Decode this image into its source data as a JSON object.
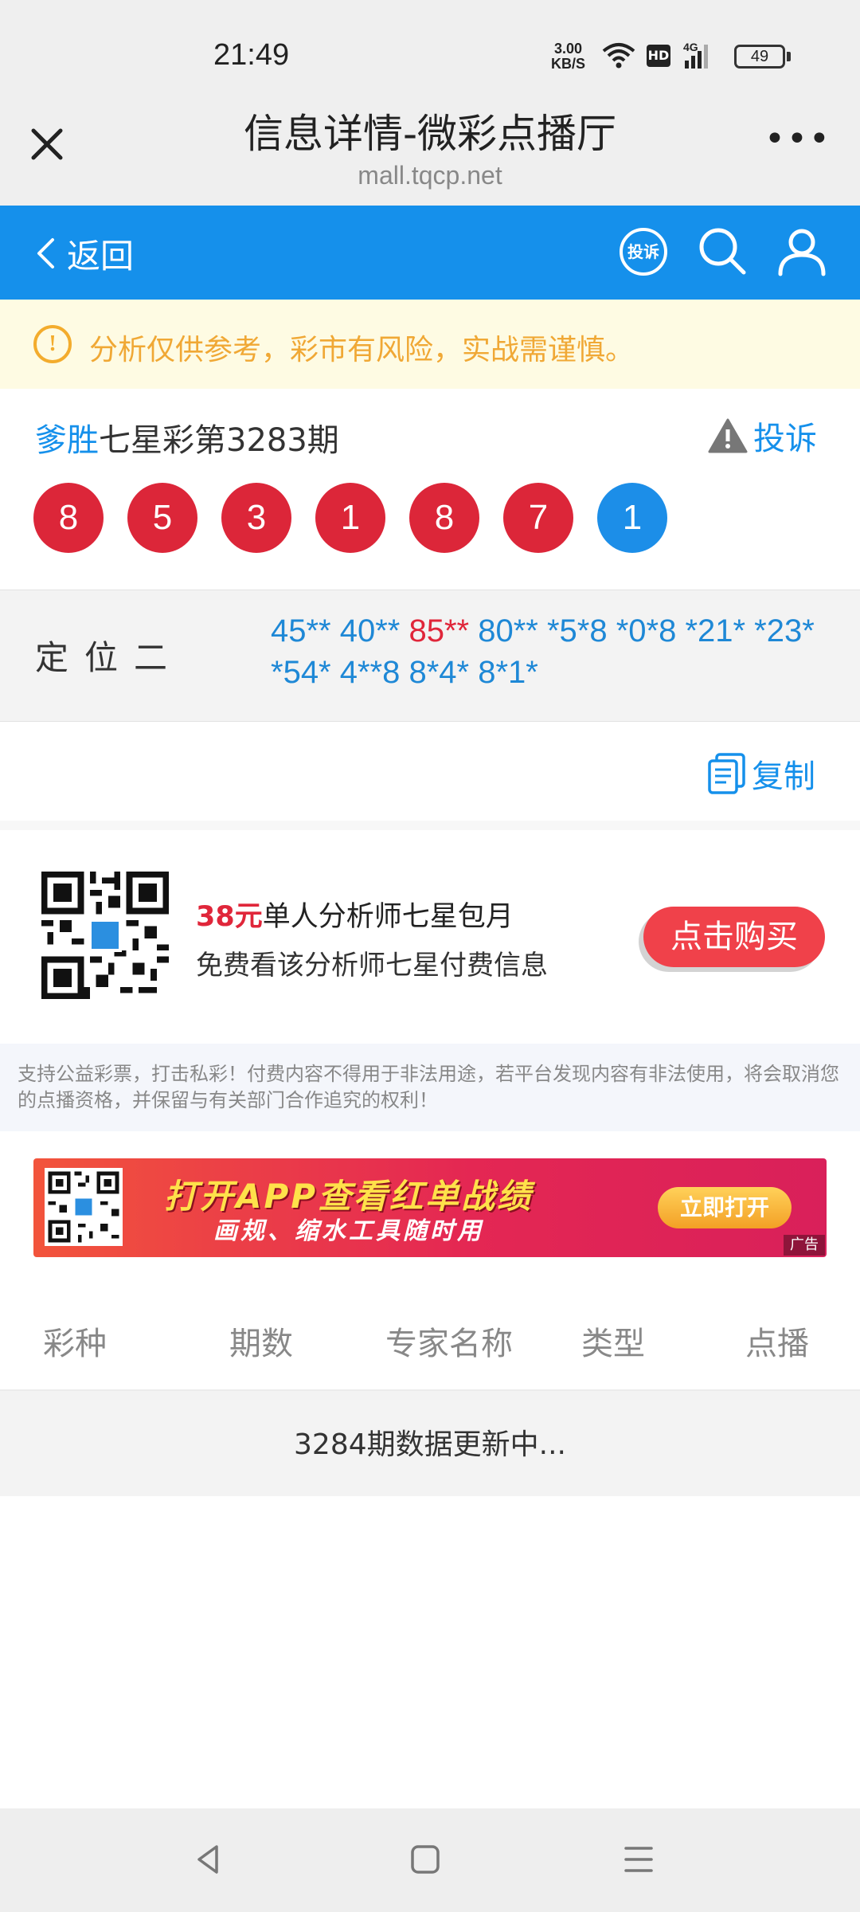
{
  "status_bar": {
    "time": "21:49",
    "net_speed_value": "3.00",
    "net_speed_unit": "KB/S",
    "hd": "HD",
    "network": "4G",
    "battery": "49"
  },
  "browser": {
    "title": "信息详情-微彩点播厅",
    "url": "mall.tqcp.net",
    "more": "•••"
  },
  "nav": {
    "back_label": "返回",
    "complaint_icon_label": "投诉"
  },
  "notice": {
    "icon": "!",
    "text": "分析仅供参考，彩市有风险，实战需谨慎。"
  },
  "draw": {
    "analyst": "爹胜",
    "title": "七星彩第3283期",
    "report_label": "投诉",
    "balls_red": [
      "8",
      "5",
      "3",
      "1",
      "8",
      "7"
    ],
    "ball_blue": "1"
  },
  "prediction": {
    "label": "定位二",
    "nums_before_hot": "45** 40** ",
    "nums_hot": "85**",
    "nums_after_hot": " 80** *5*8 *0*8 *21* *23* *54* 4**8 8*4* 8*1*"
  },
  "copy_label": "复制",
  "purchase": {
    "price": "38元",
    "title": "单人分析师七星包月",
    "subtitle": "免费看该分析师七星付费信息",
    "buy_label": "点击购买"
  },
  "disclaimer": "支持公益彩票，打击私彩！付费内容不得用于非法用途，若平台发现内容有非法使用，将会取消您的点播资格，并保留与有关部门合作追究的权利！",
  "banner": {
    "title": "打开APP查看红单战绩",
    "subtitle": "画规、缩水工具随时用",
    "button": "立即打开",
    "ad": "广告"
  },
  "table": {
    "headers": [
      "彩种",
      "期数",
      "专家名称",
      "类型",
      "点播"
    ]
  },
  "status_message": "3284期数据更新中...",
  "colors": {
    "primary": "#1590eb",
    "red_ball": "#dc2639",
    "blue_ball": "#1c8ee8",
    "notice_text": "#f0a835",
    "buy_button": "#f0414a"
  }
}
